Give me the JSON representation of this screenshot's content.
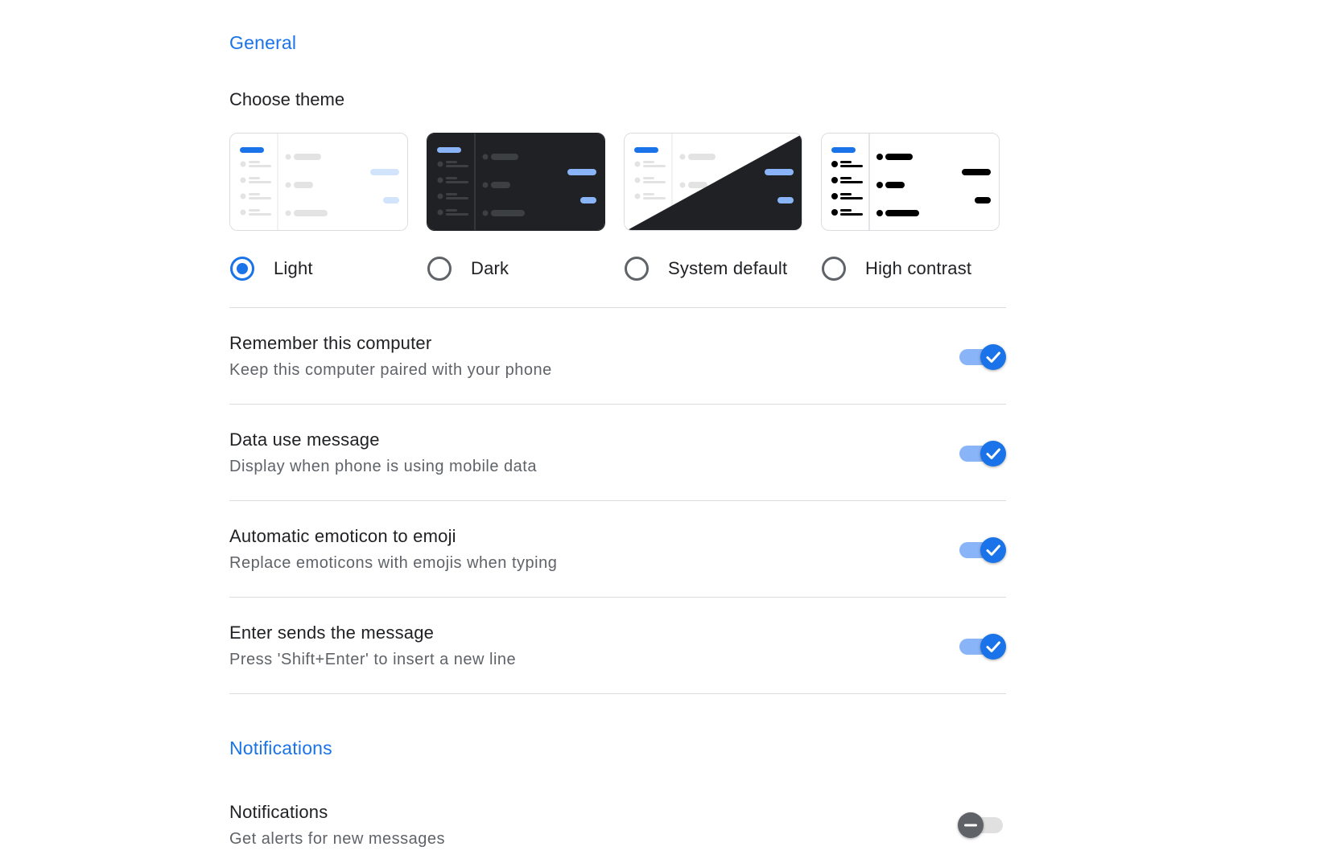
{
  "general": {
    "title": "General",
    "choose_theme_label": "Choose theme",
    "themes": [
      {
        "label": "Light",
        "selected": true
      },
      {
        "label": "Dark",
        "selected": false
      },
      {
        "label": "System default",
        "selected": false
      },
      {
        "label": "High contrast",
        "selected": false
      }
    ],
    "settings": [
      {
        "title": "Remember this computer",
        "subtitle": "Keep this computer paired with your phone",
        "enabled": true
      },
      {
        "title": "Data use message",
        "subtitle": "Display when phone is using mobile data",
        "enabled": true
      },
      {
        "title": "Automatic emoticon to emoji",
        "subtitle": "Replace emoticons with emojis when typing",
        "enabled": true
      },
      {
        "title": "Enter sends the message",
        "subtitle": "Press 'Shift+Enter' to insert a new line",
        "enabled": true
      }
    ]
  },
  "notifications": {
    "title": "Notifications",
    "settings": [
      {
        "title": "Notifications",
        "subtitle": "Get alerts for new messages",
        "enabled": false
      }
    ]
  },
  "colors": {
    "accent": "#1a73e8",
    "toggle_track_on": "#8ab4f8",
    "toggle_off_knob": "#5f6368",
    "dark_theme_bg": "#202124"
  },
  "icons": {
    "toggle_on": "check-icon",
    "toggle_off": "minus-icon"
  }
}
